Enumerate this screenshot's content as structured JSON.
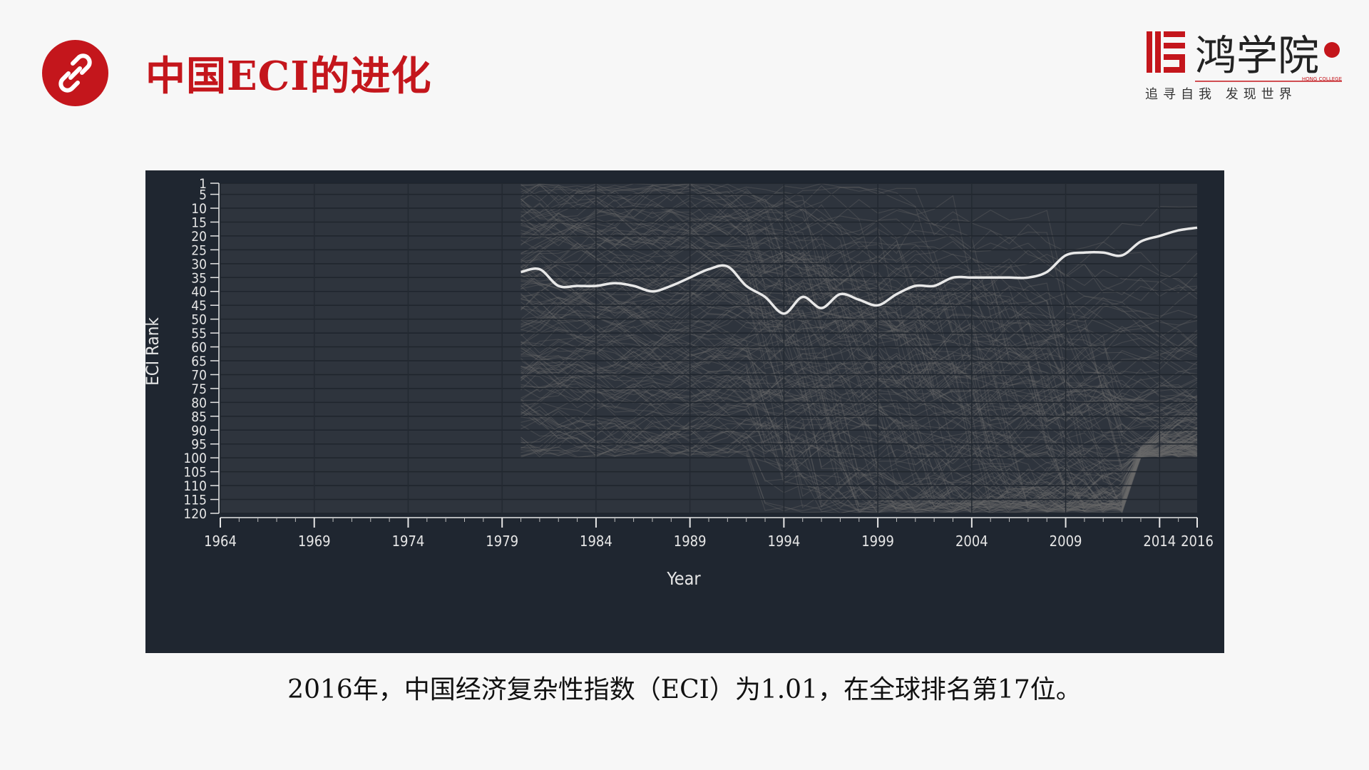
{
  "header": {
    "title": "中国ECI的进化",
    "icon": "link-icon"
  },
  "logo": {
    "name": "鸿学院",
    "english": "HONG COLLEGE",
    "slogan": "追寻自我  发现世界",
    "color": "#c4161c"
  },
  "caption": "2016年，中国经济复杂性指数（ECI）为1.01，在全球排名第17位。",
  "chart_data": {
    "type": "line",
    "title": "",
    "xlabel": "Year",
    "ylabel": "ECI Rank",
    "xlim": [
      1964,
      2016
    ],
    "ylim": [
      120,
      1
    ],
    "y_inverted": true,
    "x_tick_labels": [
      "1964",
      "1969",
      "1974",
      "1979",
      "1984",
      "1989",
      "1994",
      "1999",
      "2004",
      "2009",
      "2014",
      "2016"
    ],
    "y_tick_labels": [
      "1",
      "5",
      "10",
      "15",
      "20",
      "25",
      "30",
      "35",
      "40",
      "45",
      "50",
      "55",
      "60",
      "65",
      "70",
      "75",
      "80",
      "85",
      "90",
      "95",
      "100",
      "105",
      "110",
      "115",
      "120"
    ],
    "background": "#1f2630",
    "highlight_color": "#e8e8e8",
    "other_countries_color": "#6a6a6a",
    "series": [
      {
        "x": [
          1980,
          1981,
          1982,
          1983,
          1984,
          1985,
          1986,
          1987,
          1988,
          1989,
          1990,
          1991,
          1992,
          1993,
          1994,
          1995,
          1996,
          1997,
          1998,
          1999,
          2000,
          2001,
          2002,
          2003,
          2004,
          2005,
          2006,
          2007,
          2008,
          2009,
          2010,
          2011,
          2012,
          2013,
          2014,
          2015,
          2016
        ],
        "y": [
          33,
          32,
          38,
          38,
          38,
          37,
          38,
          40,
          38,
          35,
          32,
          31,
          38,
          42,
          48,
          42,
          46,
          41,
          43,
          45,
          41,
          38,
          38,
          35,
          35,
          35,
          35,
          35,
          33,
          27,
          26,
          26,
          27,
          22,
          20,
          18,
          17
        ]
      }
    ]
  }
}
